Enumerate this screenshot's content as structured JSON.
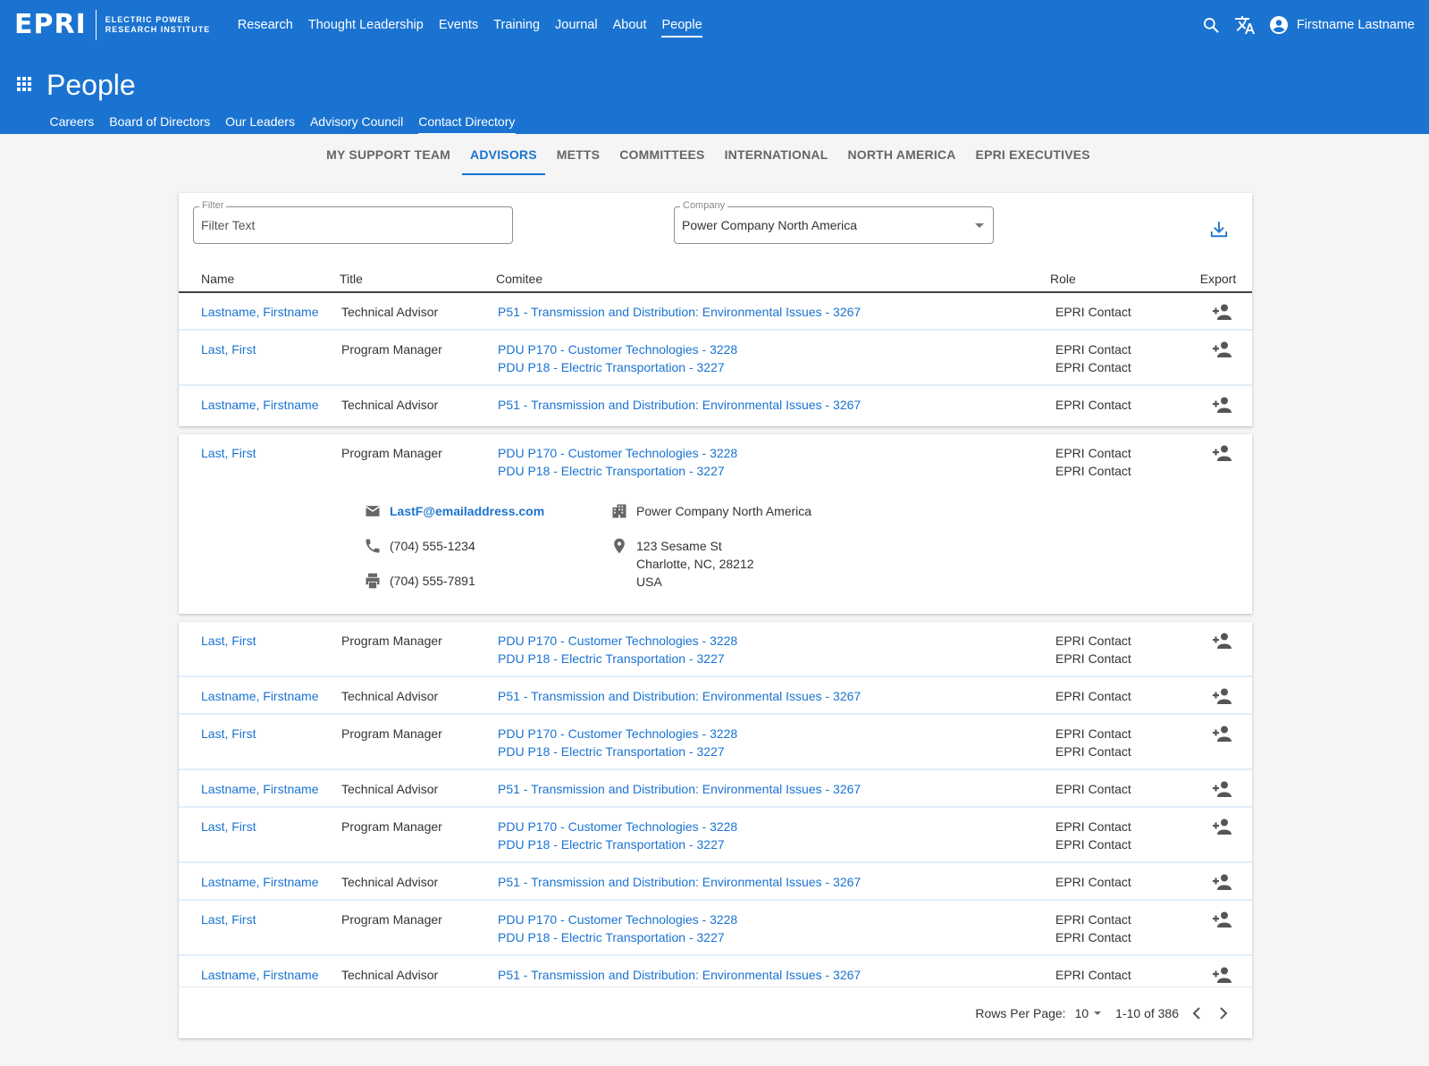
{
  "brand": {
    "logo": "EPRI",
    "line1": "ELECTRIC POWER",
    "line2": "RESEARCH INSTITUTE"
  },
  "nav": [
    "Research",
    "Thought Leadership",
    "Events",
    "Training",
    "Journal",
    "About",
    "People"
  ],
  "user": {
    "name": "Firstname Lastname"
  },
  "page": {
    "title": "People"
  },
  "subnav": [
    "Careers",
    "Board of Directors",
    "Our Leaders",
    "Advisory Council",
    "Contact Directory"
  ],
  "tabs": [
    "MY SUPPORT TEAM",
    "ADVISORS",
    "METTS",
    "COMMITTEES",
    "INTERNATIONAL",
    "NORTH AMERICA",
    "EPRI EXECUTIVES"
  ],
  "filter": {
    "label": "Filter",
    "placeholder": "Filter Text"
  },
  "company": {
    "label": "Company",
    "value": "Power Company North America"
  },
  "columns": {
    "name": "Name",
    "title": "Title",
    "committee": "Comitee",
    "role": "Role",
    "export": "Export"
  },
  "rows_top": [
    {
      "name": "Lastname, Firstname",
      "title": "Technical Advisor",
      "committees": [
        "P51 - Transmission and Distribution: Environmental Issues - 3267"
      ],
      "roles": [
        "EPRI Contact"
      ]
    },
    {
      "name": "Last, First",
      "title": "Program Manager",
      "committees": [
        "PDU P170 - Customer Technologies - 3228",
        "PDU P18 - Electric Transportation - 3227"
      ],
      "roles": [
        "EPRI Contact",
        "EPRI Contact"
      ]
    },
    {
      "name": "Lastname, Firstname",
      "title": "Technical Advisor",
      "committees": [
        "P51 - Transmission and Distribution: Environmental Issues - 3267"
      ],
      "roles": [
        "EPRI Contact"
      ]
    }
  ],
  "expanded": {
    "name": "Last, First",
    "title": "Program Manager",
    "committees": [
      "PDU P170 - Customer Technologies - 3228",
      "PDU P18 - Electric Transportation - 3227"
    ],
    "roles": [
      "EPRI Contact",
      "EPRI Contact"
    ],
    "email": "LastF@emailaddress.com",
    "phone": "(704) 555-1234",
    "fax": "(704) 555-7891",
    "company": "Power Company North America",
    "address": [
      "123 Sesame St",
      "Charlotte, NC, 28212",
      "USA"
    ]
  },
  "rows_bottom": [
    {
      "name": "Last, First",
      "title": "Program Manager",
      "committees": [
        "PDU P170 - Customer Technologies - 3228",
        "PDU P18 - Electric Transportation - 3227"
      ],
      "roles": [
        "EPRI Contact",
        "EPRI Contact"
      ]
    },
    {
      "name": "Lastname, Firstname",
      "title": "Technical Advisor",
      "committees": [
        "P51 - Transmission and Distribution: Environmental Issues - 3267"
      ],
      "roles": [
        "EPRI Contact"
      ]
    },
    {
      "name": "Last, First",
      "title": "Program Manager",
      "committees": [
        "PDU P170 - Customer Technologies - 3228",
        "PDU P18 - Electric Transportation - 3227"
      ],
      "roles": [
        "EPRI Contact",
        "EPRI Contact"
      ]
    },
    {
      "name": "Lastname, Firstname",
      "title": "Technical Advisor",
      "committees": [
        "P51 - Transmission and Distribution: Environmental Issues - 3267"
      ],
      "roles": [
        "EPRI Contact"
      ]
    },
    {
      "name": "Last, First",
      "title": "Program Manager",
      "committees": [
        "PDU P170 - Customer Technologies - 3228",
        "PDU P18 - Electric Transportation - 3227"
      ],
      "roles": [
        "EPRI Contact",
        "EPRI Contact"
      ]
    },
    {
      "name": "Lastname, Firstname",
      "title": "Technical Advisor",
      "committees": [
        "P51 - Transmission and Distribution: Environmental Issues - 3267"
      ],
      "roles": [
        "EPRI Contact"
      ]
    },
    {
      "name": "Last, First",
      "title": "Program Manager",
      "committees": [
        "PDU P170 - Customer Technologies - 3228",
        "PDU P18 - Electric Transportation - 3227"
      ],
      "roles": [
        "EPRI Contact",
        "EPRI Contact"
      ]
    },
    {
      "name": "Lastname, Firstname",
      "title": "Technical Advisor",
      "committees": [
        "P51 - Transmission and Distribution: Environmental Issues - 3267"
      ],
      "roles": [
        "EPRI Contact"
      ]
    }
  ],
  "pagination": {
    "rows_label": "Rows Per Page:",
    "rows_value": "10",
    "range": "1-10 of 386"
  },
  "colors": {
    "primary": "#1a73d1",
    "row_divider": "#e3eef9"
  },
  "icons": {
    "search": "search-icon",
    "translate": "translate-icon",
    "account": "account-circle-icon",
    "apps": "apps-grid-icon",
    "download": "download-icon",
    "add_person": "person-add-icon",
    "email": "email-icon",
    "phone": "phone-icon",
    "fax": "printer-icon",
    "company": "building-icon",
    "location": "location-pin-icon"
  }
}
